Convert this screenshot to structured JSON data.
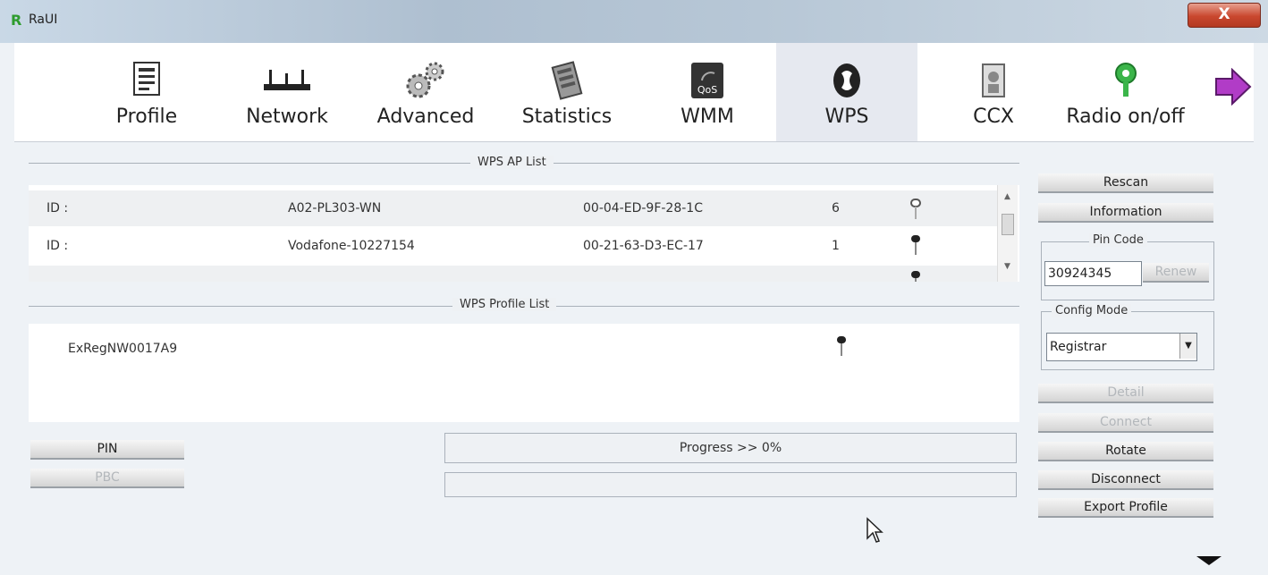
{
  "window": {
    "title": "RaUI",
    "close_label": "X"
  },
  "toolbar": {
    "items": [
      {
        "label": "Profile",
        "icon": "profile-icon"
      },
      {
        "label": "Network",
        "icon": "network-icon"
      },
      {
        "label": "Advanced",
        "icon": "gears-icon"
      },
      {
        "label": "Statistics",
        "icon": "statistics-icon"
      },
      {
        "label": "WMM",
        "icon": "qos-icon",
        "icon_text": "QoS"
      },
      {
        "label": "WPS",
        "icon": "wps-icon",
        "active": true
      },
      {
        "label": "CCX",
        "icon": "ccx-icon"
      },
      {
        "label": "Radio on/off",
        "icon": "radio-icon"
      }
    ],
    "next_icon": "arrow-right-icon"
  },
  "ap_list": {
    "title": "WPS AP List",
    "rows": [
      {
        "id_label": "ID :",
        "ssid": "A02-PL303-WN",
        "mac": "00-04-ED-9F-28-1C",
        "channel": "6"
      },
      {
        "id_label": "ID :",
        "ssid": "Vodafone-10227154",
        "mac": "00-21-63-D3-EC-17",
        "channel": "1"
      }
    ]
  },
  "profile_list": {
    "title": "WPS Profile List",
    "items": [
      {
        "name": "ExRegNW0017A9"
      }
    ]
  },
  "buttons_left": {
    "pin": "PIN",
    "pbc": "PBC"
  },
  "progress": {
    "text": "Progress >> 0%",
    "value_percent": 0
  },
  "side": {
    "rescan": "Rescan",
    "information": "Information",
    "pin_code_legend": "Pin Code",
    "pin_code_value": "30924345",
    "renew": "Renew",
    "config_mode_legend": "Config Mode",
    "config_mode_value": "Registrar",
    "detail": "Detail",
    "connect": "Connect",
    "rotate": "Rotate",
    "disconnect": "Disconnect",
    "export_profile": "Export Profile"
  }
}
